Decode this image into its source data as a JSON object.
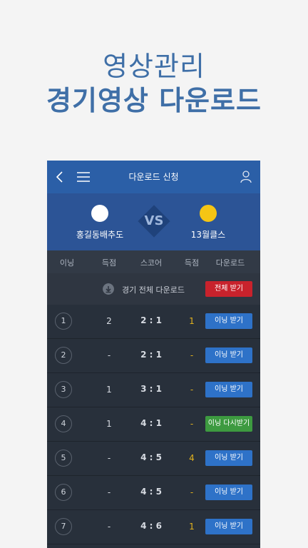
{
  "promo": {
    "line1": "영상관리",
    "line2": "경기영상 다운로드"
  },
  "appbar": {
    "title": "다운로드 신청"
  },
  "match": {
    "home_team": "홍길동배추도",
    "away_team": "13월클스",
    "vs": "VS",
    "home_color": "#ffffff",
    "away_color": "#f5c514"
  },
  "columns": {
    "inning": "이닝",
    "score_home": "득점",
    "score": "스코어",
    "score_away": "득점",
    "download": "다운로드"
  },
  "all_download": {
    "label": "경기 전체 다운로드",
    "button": "전체 받기"
  },
  "rows": [
    {
      "inning": "1",
      "home": "2",
      "score": "2 : 1",
      "away": "1",
      "button": "이닝 받기",
      "state": "blue"
    },
    {
      "inning": "2",
      "home": "-",
      "score": "2 : 1",
      "away": "-",
      "button": "이닝 받기",
      "state": "blue"
    },
    {
      "inning": "3",
      "home": "1",
      "score": "3 : 1",
      "away": "-",
      "button": "이닝 받기",
      "state": "blue"
    },
    {
      "inning": "4",
      "home": "1",
      "score": "4 : 1",
      "away": "-",
      "button": "이닝 다시받기",
      "state": "green"
    },
    {
      "inning": "5",
      "home": "-",
      "score": "4 : 5",
      "away": "4",
      "button": "이닝 받기",
      "state": "blue"
    },
    {
      "inning": "6",
      "home": "-",
      "score": "4 : 5",
      "away": "-",
      "button": "이닝 받기",
      "state": "blue"
    },
    {
      "inning": "7",
      "home": "-",
      "score": "4 : 6",
      "away": "1",
      "button": "이닝 받기",
      "state": "blue"
    }
  ]
}
